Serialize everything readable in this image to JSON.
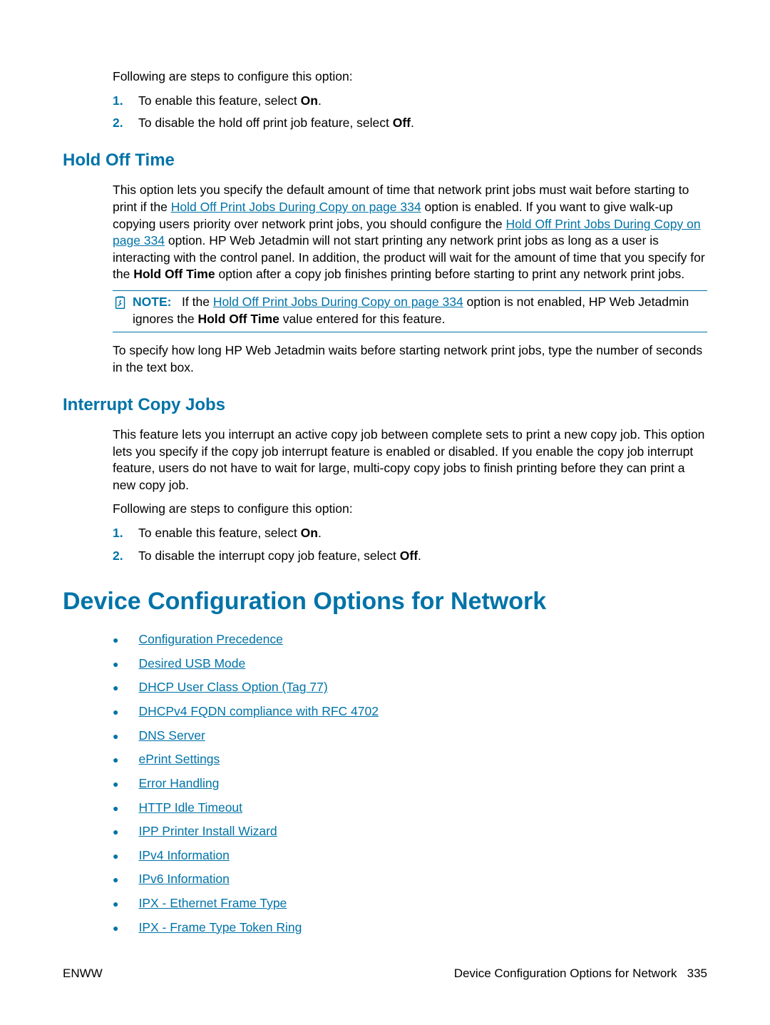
{
  "intro1": "Following are steps to configure this option:",
  "step1_pre": "To enable this feature, select ",
  "step1_bold": "On",
  "step2_pre": "To disable the hold off print job feature, select ",
  "step2_bold": "Off",
  "num1": "1.",
  "num2": "2.",
  "hold_heading": "Hold Off Time",
  "hold_p1_a": "This option lets you specify the default amount of time that network print jobs must wait before starting to print if the ",
  "hold_p1_link1": "Hold Off Print Jobs During Copy on page 334",
  "hold_p1_b": " option is enabled. If you want to give walk-up copying users priority over network print jobs, you should configure the ",
  "hold_p1_link2": "Hold Off Print Jobs During Copy on page 334",
  "hold_p1_c": " option. HP Web Jetadmin will not start printing any network print jobs as long as a user is interacting with the control panel. In addition, the product will wait for the amount of time that you specify for the ",
  "hold_p1_bold": "Hold Off Time",
  "hold_p1_d": " option after a copy job finishes printing before starting to print any network print jobs.",
  "note_label": "NOTE:",
  "note_a": "If the ",
  "note_link": "Hold Off Print Jobs During Copy on page 334",
  "note_b": " option is not enabled, HP Web Jetadmin ignores the ",
  "note_bold": "Hold Off Time",
  "note_c": " value entered for this feature.",
  "hold_p2": "To specify how long HP Web Jetadmin waits before starting network print jobs, type the number of seconds in the text box.",
  "interrupt_heading": "Interrupt Copy Jobs",
  "interrupt_p1": "This feature lets you interrupt an active copy job between complete sets to print a new copy job. This option lets you specify if the copy job interrupt feature is enabled or disabled. If you enable the copy job interrupt feature, users do not have to wait for large, multi-copy copy jobs to finish printing before they can print a new copy job.",
  "interrupt_p2": "Following are steps to configure this option:",
  "istep1_pre": "To enable this feature, select ",
  "istep1_bold": "On",
  "istep2_pre": "To disable the interrupt copy job feature, select ",
  "istep2_bold": "Off",
  "network_heading": "Device Configuration Options for Network",
  "toc": [
    "Configuration Precedence",
    "Desired USB Mode",
    "DHCP User Class Option (Tag 77)",
    "DHCPv4 FQDN compliance with RFC 4702",
    "DNS Server",
    "ePrint Settings",
    "Error Handling",
    "HTTP Idle Timeout",
    "IPP Printer Install Wizard",
    "IPv4 Information",
    "IPv6 Information",
    "IPX - Ethernet Frame Type",
    "IPX - Frame Type Token Ring"
  ],
  "footer_left": "ENWW",
  "footer_right_text": "Device Configuration Options for Network",
  "footer_page": "335"
}
